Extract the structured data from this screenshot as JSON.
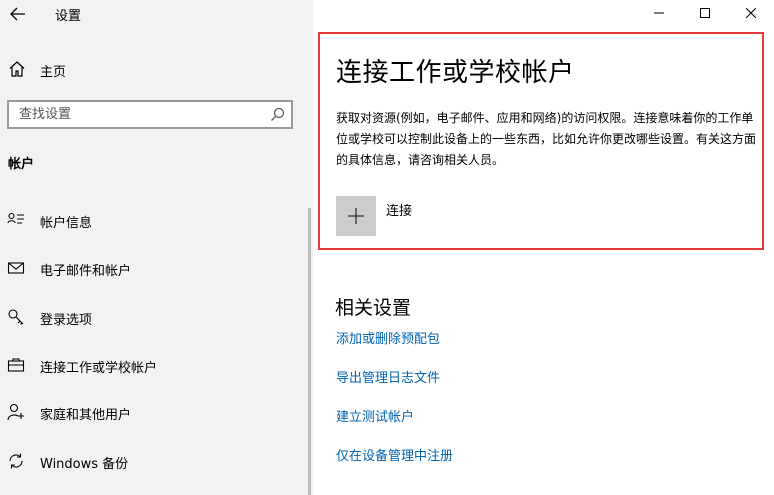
{
  "app": {
    "title": "设置"
  },
  "sidebar": {
    "home_label": "主页",
    "search_placeholder": "查找设置",
    "section_title": "帐户",
    "items": [
      {
        "label": "帐户信息",
        "icon": "account-info-icon"
      },
      {
        "label": "电子邮件和帐户",
        "icon": "mail-icon"
      },
      {
        "label": "登录选项",
        "icon": "key-icon"
      },
      {
        "label": "连接工作或学校帐户",
        "icon": "briefcase-icon"
      },
      {
        "label": "家庭和其他用户",
        "icon": "person-add-icon"
      },
      {
        "label": "Windows 备份",
        "icon": "sync-icon"
      }
    ]
  },
  "main": {
    "title": "连接工作或学校帐户",
    "description": "获取对资源(例如，电子邮件、应用和网络)的访问权限。连接意味着你的工作单位或学校可以控制此设备上的一些东西，比如允许你更改哪些设置。有关这方面的具体信息，请咨询相关人员。",
    "connect_label": "连接",
    "related_title": "相关设置",
    "links": [
      "添加或删除预配包",
      "导出管理日志文件",
      "建立测试帐户",
      "仅在设备管理中注册"
    ]
  },
  "colors": {
    "link": "#0063b1",
    "highlight_border": "#e23b3b",
    "sidebar_bg": "#f2f2f2"
  }
}
